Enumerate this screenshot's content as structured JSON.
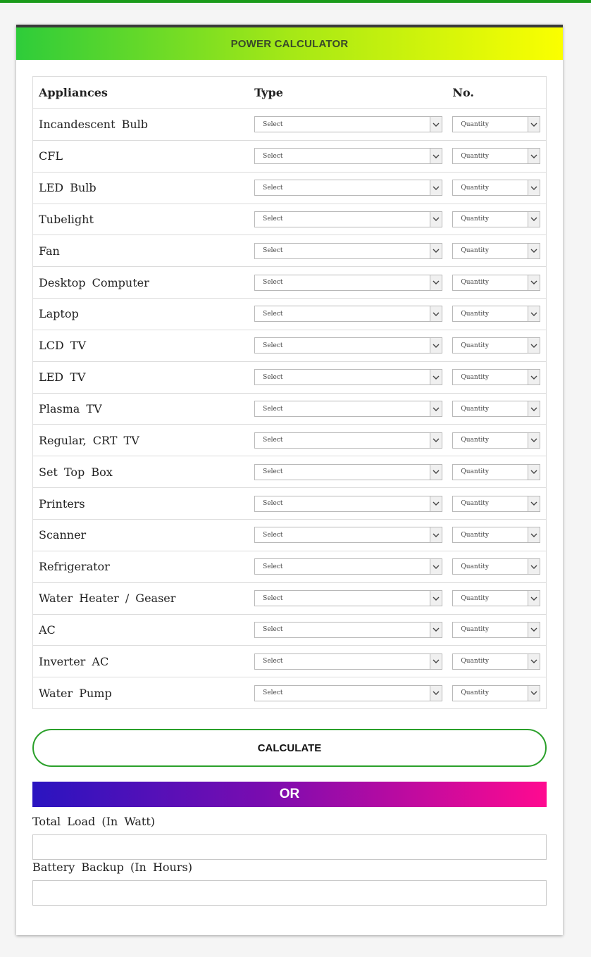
{
  "header": {
    "title": "POWER CALCULATOR"
  },
  "table": {
    "columns": [
      "Appliances",
      "Type",
      "No."
    ],
    "type_placeholder": "Select",
    "quantity_placeholder": "Quantity",
    "appliances": [
      "Incandescent Bulb",
      "CFL",
      "LED Bulb",
      "Tubelight",
      "Fan",
      "Desktop Computer",
      "Laptop",
      "LCD TV",
      "LED TV",
      "Plasma TV",
      "Regular, CRT TV",
      "Set Top Box",
      "Printers",
      "Scanner",
      "Refrigerator",
      "Water Heater / Geaser",
      "AC",
      "Inverter AC",
      "Water Pump"
    ]
  },
  "actions": {
    "calculate_label": "CALCULATE",
    "or_label": "OR"
  },
  "fields": {
    "total_load_label": "Total Load (In Watt)",
    "total_load_value": "",
    "battery_backup_label": "Battery Backup (In Hours)",
    "battery_backup_value": ""
  },
  "colors": {
    "header_gradient": [
      "#2ecc3a",
      "#fbff00"
    ],
    "or_gradient": [
      "#2a14c0",
      "#ff0a90"
    ],
    "accent_green": "#2aa02a"
  },
  "icons": {
    "dropdown_arrow": "chevron-down-icon"
  }
}
